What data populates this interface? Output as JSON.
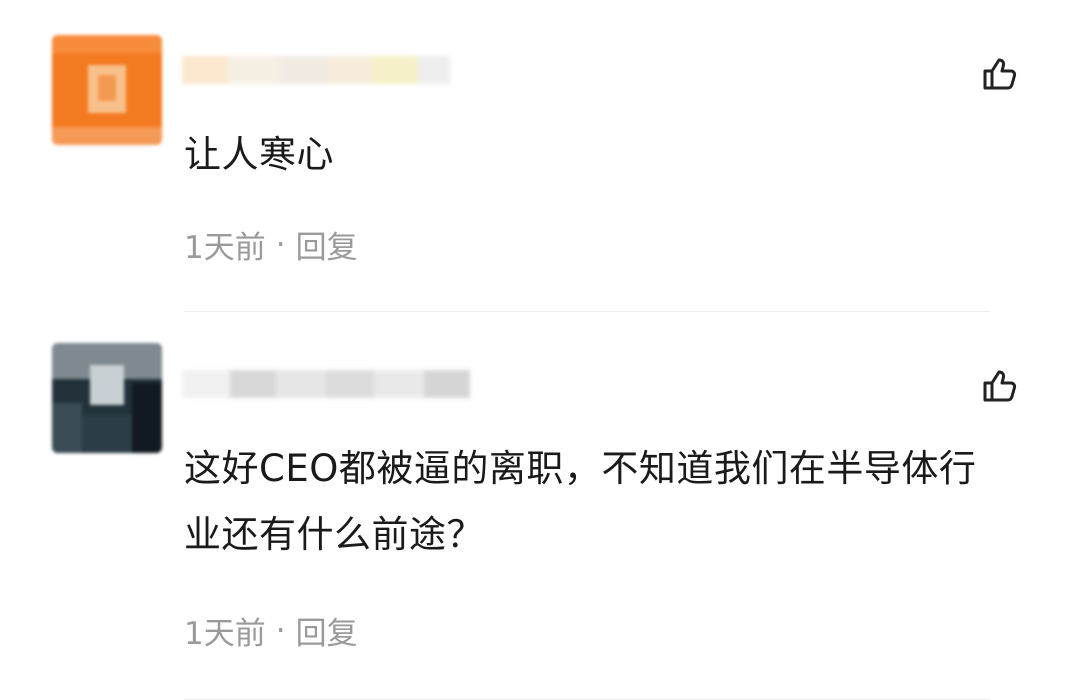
{
  "comments": [
    {
      "text": "让人寒心",
      "time": "1天前",
      "separator": "·",
      "reply_label": "回复",
      "avatar_color": "#f47a22"
    },
    {
      "text": "这好CEO都被逼的离职，不知道我们在半导体行业还有什么前途？",
      "time": "1天前",
      "separator": "·",
      "reply_label": "回复",
      "avatar_color": "#22313a"
    }
  ],
  "icons": {
    "like": "thumbs-up-icon"
  },
  "colors": {
    "text": "#1a1a1a",
    "meta": "#9a9a9a"
  }
}
